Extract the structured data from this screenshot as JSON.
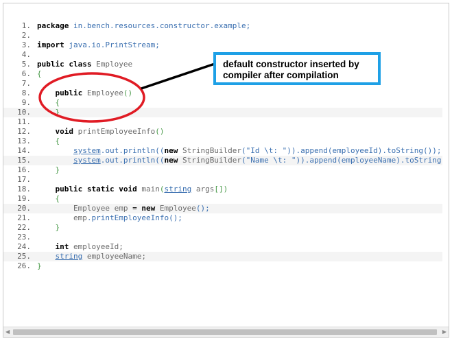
{
  "lines": [
    {
      "n": "1.",
      "t": [
        {
          "c": "kw",
          "v": "package"
        },
        {
          "c": "",
          "v": " "
        },
        {
          "c": "pk",
          "v": "in.bench.resources.constructor.example;"
        }
      ]
    },
    {
      "n": "2.",
      "t": []
    },
    {
      "n": "3.",
      "t": [
        {
          "c": "kw",
          "v": "import"
        },
        {
          "c": "",
          "v": " "
        },
        {
          "c": "pk",
          "v": "java.io.PrintStream;"
        }
      ]
    },
    {
      "n": "4.",
      "t": []
    },
    {
      "n": "5.",
      "t": [
        {
          "c": "kw",
          "v": "public class"
        },
        {
          "c": "",
          "v": " "
        },
        {
          "c": "id",
          "v": "Employee"
        }
      ]
    },
    {
      "n": "6.",
      "t": [
        {
          "c": "gr",
          "v": "{"
        }
      ]
    },
    {
      "n": "7.",
      "t": []
    },
    {
      "n": "8.",
      "t": [
        {
          "c": "",
          "v": "    "
        },
        {
          "c": "kw",
          "v": "public"
        },
        {
          "c": "",
          "v": " "
        },
        {
          "c": "id",
          "v": "Employee"
        },
        {
          "c": "gr",
          "v": "()"
        }
      ]
    },
    {
      "n": "9.",
      "t": [
        {
          "c": "",
          "v": "    "
        },
        {
          "c": "gr",
          "v": "{"
        }
      ]
    },
    {
      "n": "10.",
      "t": [
        {
          "c": "",
          "v": "    "
        },
        {
          "c": "gr",
          "v": "}"
        }
      ]
    },
    {
      "n": "11.",
      "t": []
    },
    {
      "n": "12.",
      "t": [
        {
          "c": "",
          "v": "    "
        },
        {
          "c": "kw",
          "v": "void"
        },
        {
          "c": "",
          "v": " "
        },
        {
          "c": "id",
          "v": "printEmployeeInfo"
        },
        {
          "c": "gr",
          "v": "()"
        }
      ]
    },
    {
      "n": "13.",
      "t": [
        {
          "c": "",
          "v": "    "
        },
        {
          "c": "gr",
          "v": "{"
        }
      ]
    },
    {
      "n": "14.",
      "t": [
        {
          "c": "",
          "v": "        "
        },
        {
          "c": "st",
          "v": "system"
        },
        {
          "c": "pu",
          "v": ".out.println(("
        },
        {
          "c": "kw",
          "v": "new"
        },
        {
          "c": "",
          "v": " "
        },
        {
          "c": "id",
          "v": "StringBuilder"
        },
        {
          "c": "pu",
          "v": "(\"Id \\t: \")).append(employeeId).toString());"
        }
      ]
    },
    {
      "n": "15.",
      "t": [
        {
          "c": "",
          "v": "        "
        },
        {
          "c": "st",
          "v": "system"
        },
        {
          "c": "pu",
          "v": ".out.println(("
        },
        {
          "c": "kw",
          "v": "new"
        },
        {
          "c": "",
          "v": " "
        },
        {
          "c": "id",
          "v": "StringBuilder"
        },
        {
          "c": "pu",
          "v": "(\"Name \\t: \")).append(employeeName).toString());"
        }
      ]
    },
    {
      "n": "16.",
      "t": [
        {
          "c": "",
          "v": "    "
        },
        {
          "c": "gr",
          "v": "}"
        }
      ]
    },
    {
      "n": "17.",
      "t": []
    },
    {
      "n": "18.",
      "t": [
        {
          "c": "",
          "v": "    "
        },
        {
          "c": "kw",
          "v": "public static void"
        },
        {
          "c": "",
          "v": " "
        },
        {
          "c": "id",
          "v": "main"
        },
        {
          "c": "gr",
          "v": "("
        },
        {
          "c": "ty",
          "v": "string"
        },
        {
          "c": "",
          "v": " "
        },
        {
          "c": "id",
          "v": "args"
        },
        {
          "c": "gr",
          "v": "[])"
        }
      ]
    },
    {
      "n": "19.",
      "t": [
        {
          "c": "",
          "v": "    "
        },
        {
          "c": "gr",
          "v": "{"
        }
      ]
    },
    {
      "n": "20.",
      "t": [
        {
          "c": "",
          "v": "        "
        },
        {
          "c": "id",
          "v": "Employee emp"
        },
        {
          "c": "",
          "v": " = "
        },
        {
          "c": "kw",
          "v": "new"
        },
        {
          "c": "",
          "v": " "
        },
        {
          "c": "id",
          "v": "Employee"
        },
        {
          "c": "pu",
          "v": "();"
        }
      ]
    },
    {
      "n": "21.",
      "t": [
        {
          "c": "",
          "v": "        "
        },
        {
          "c": "id",
          "v": "emp"
        },
        {
          "c": "pu",
          "v": ".printEmployeeInfo();"
        }
      ]
    },
    {
      "n": "22.",
      "t": [
        {
          "c": "",
          "v": "    "
        },
        {
          "c": "gr",
          "v": "}"
        }
      ]
    },
    {
      "n": "23.",
      "t": []
    },
    {
      "n": "24.",
      "t": [
        {
          "c": "",
          "v": "    "
        },
        {
          "c": "kw",
          "v": "int"
        },
        {
          "c": "",
          "v": " "
        },
        {
          "c": "id",
          "v": "employeeId;"
        }
      ]
    },
    {
      "n": "25.",
      "t": [
        {
          "c": "",
          "v": "    "
        },
        {
          "c": "ty",
          "v": "string"
        },
        {
          "c": "",
          "v": " "
        },
        {
          "c": "id",
          "v": "employeeName;"
        }
      ]
    },
    {
      "n": "26.",
      "t": [
        {
          "c": "gr",
          "v": "}"
        }
      ]
    }
  ],
  "callout": {
    "line1": "default constructor inserted by",
    "line2": "compiler after compilation",
    "border_color": "#1ea0e6"
  },
  "annotation": {
    "ellipse_color": "#e01b24",
    "pointer_color": "#000000"
  },
  "scrollbar": {
    "left_arrow_icon": "triangle-left-icon",
    "right_arrow_icon": "triangle-right-icon",
    "left_glyph": "◀",
    "right_glyph": "▶"
  }
}
